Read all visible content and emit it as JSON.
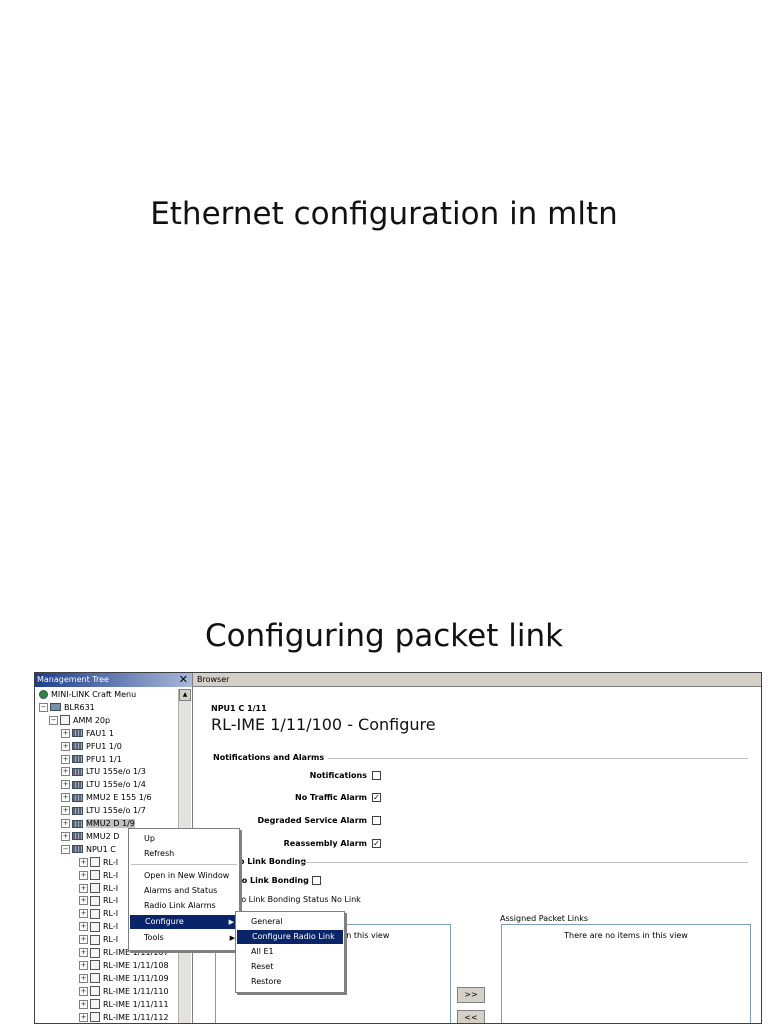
{
  "slide": {
    "title1": "Ethernet configuration in mltn",
    "title2": "Configuring packet link"
  },
  "tree": {
    "header": "Management Tree",
    "close": "✕",
    "nodes": [
      {
        "label": "MINI-LINK Craft Menu",
        "level": 0,
        "icon": "root",
        "pm": ""
      },
      {
        "label": "BLR631",
        "level": 0,
        "icon": "node",
        "pm": "−"
      },
      {
        "label": "AMM 20p",
        "level": 1,
        "icon": "doc",
        "pm": "−"
      },
      {
        "label": "FAU1 1",
        "level": 2,
        "icon": "card",
        "pm": "+"
      },
      {
        "label": "PFU1 1/0",
        "level": 2,
        "icon": "card",
        "pm": "+"
      },
      {
        "label": "PFU1 1/1",
        "level": 2,
        "icon": "card",
        "pm": "+"
      },
      {
        "label": "LTU 155e/o 1/3",
        "level": 2,
        "icon": "card",
        "pm": "+"
      },
      {
        "label": "LTU 155e/o 1/4",
        "level": 2,
        "icon": "card",
        "pm": "+"
      },
      {
        "label": "MMU2 E 155 1/6",
        "level": 2,
        "icon": "card",
        "pm": "+"
      },
      {
        "label": "LTU 155e/o 1/7",
        "level": 2,
        "icon": "card",
        "pm": "+"
      },
      {
        "label": "MMU2 D 1/9",
        "level": 2,
        "icon": "card",
        "pm": "+"
      },
      {
        "label": "MMU2 D",
        "level": 2,
        "icon": "card",
        "pm": "+"
      },
      {
        "label": "NPU1 C",
        "level": 2,
        "icon": "card",
        "pm": "−"
      },
      {
        "label": "RL-I",
        "level": 3,
        "icon": "doc",
        "pm": "+"
      },
      {
        "label": "RL-I",
        "level": 3,
        "icon": "doc",
        "pm": "+"
      },
      {
        "label": "RL-I",
        "level": 3,
        "icon": "doc",
        "pm": "+"
      },
      {
        "label": "RL-I",
        "level": 3,
        "icon": "doc",
        "pm": "+"
      },
      {
        "label": "RL-I",
        "level": 3,
        "icon": "doc",
        "pm": "+"
      },
      {
        "label": "RL-I",
        "level": 3,
        "icon": "doc",
        "pm": "+"
      },
      {
        "label": "RL-I",
        "level": 3,
        "icon": "doc",
        "pm": "+"
      },
      {
        "label": "RL-IME 1/11/107",
        "level": 3,
        "icon": "doc",
        "pm": "+"
      },
      {
        "label": "RL-IME 1/11/108",
        "level": 3,
        "icon": "doc",
        "pm": "+"
      },
      {
        "label": "RL-IME 1/11/109",
        "level": 3,
        "icon": "doc",
        "pm": "+"
      },
      {
        "label": "RL-IME 1/11/110",
        "level": 3,
        "icon": "doc",
        "pm": "+"
      },
      {
        "label": "RL-IME 1/11/111",
        "level": 3,
        "icon": "doc",
        "pm": "+"
      },
      {
        "label": "RL-IME 1/11/112",
        "level": 3,
        "icon": "doc",
        "pm": "+"
      }
    ]
  },
  "browser": {
    "header": "Browser",
    "breadcrumb": "NPU1 C 1/11",
    "title": "RL-IME 1/11/100 - Configure",
    "section_notifications": "Notifications and Alarms",
    "notifications_label": "Notifications",
    "no_traffic_label": "No Traffic Alarm",
    "degraded_label": "Degraded Service Alarm",
    "reassembly_label": "Reassembly Alarm",
    "section_bonding": "o Link Bonding",
    "bonding_label": "io Link Bonding",
    "bonding_status_label": "io Link Bonding Status",
    "bonding_status_value": "No Link",
    "assigned_label": "Assigned Packet Links",
    "left_empty": "in this view",
    "right_empty": "There are no items in this view",
    "add_button": ">>",
    "remove_button": "<<",
    "checks": {
      "notifications": "",
      "no_traffic": "✓",
      "degraded": "",
      "reassembly": "✓",
      "bonding": ""
    }
  },
  "context_menu": {
    "items": [
      "Up",
      "Refresh",
      "Open in New Window",
      "Alarms and Status",
      "Radio Link Alarms",
      "Configure",
      "Tools"
    ]
  },
  "submenu": {
    "items": [
      "General",
      "Configure Radio Link",
      "All E1",
      "Reset",
      "Restore"
    ]
  }
}
